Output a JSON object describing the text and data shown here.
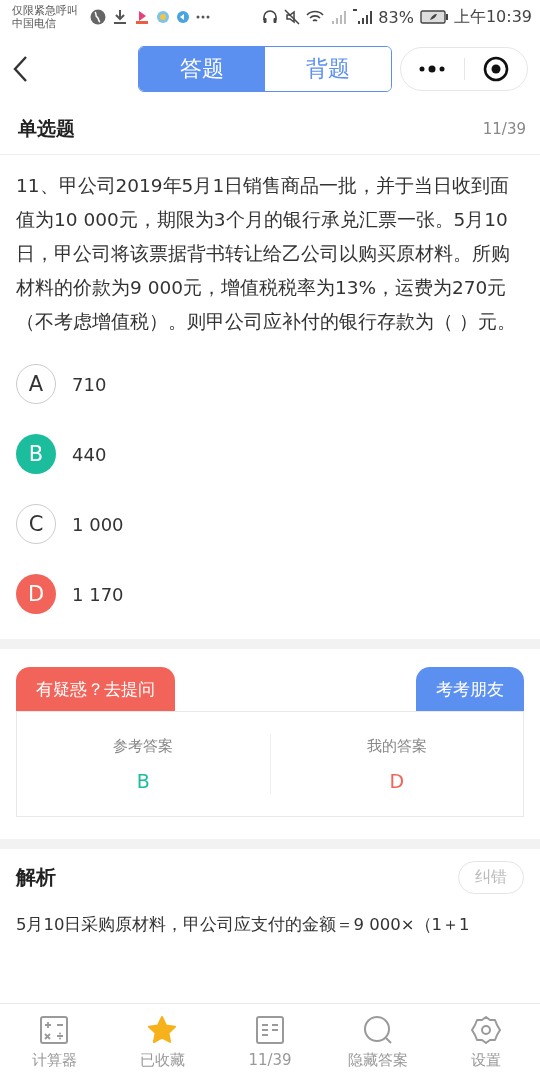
{
  "status_bar": {
    "carrier_lines": [
      "仅限紧急呼叫",
      "中国电信"
    ],
    "battery": "83%",
    "time": "上午10:39"
  },
  "header": {
    "tabs": [
      {
        "label": "答题",
        "selected": true
      },
      {
        "label": "背题",
        "selected": false
      }
    ]
  },
  "question": {
    "type": "单选题",
    "progress": "11/39",
    "text": "11、甲公司2019年5月1日销售商品一批，并于当日收到面值为10 000元，期限为3个月的银行承兑汇票一张。5月10日，甲公司将该票据背书转让给乙公司以购买原材料。所购材料的价款为9 000元，增值税税率为13%，运费为270元（不考虑增值税）。则甲公司应补付的银行存款为（ ）元。",
    "options": [
      {
        "letter": "A",
        "text": "710",
        "correct": false,
        "wrong": false
      },
      {
        "letter": "B",
        "text": "440",
        "correct": true,
        "wrong": false
      },
      {
        "letter": "C",
        "text": "1 000",
        "correct": false,
        "wrong": false
      },
      {
        "letter": "D",
        "text": "1 170",
        "correct": false,
        "wrong": true
      }
    ]
  },
  "answer": {
    "ask_button": "有疑惑？去提问",
    "friend_button": "考考朋友",
    "reference_label": "参考答案",
    "reference_value": "B",
    "mine_label": "我的答案",
    "mine_value": "D"
  },
  "analysis": {
    "title": "解析",
    "report_button": "纠错",
    "text": "5月10日采购原材料，甲公司应支付的金额＝9 000×（1＋1"
  },
  "bottom_nav": [
    {
      "kind": "calculator",
      "label": "计算器"
    },
    {
      "kind": "star",
      "label": "已收藏"
    },
    {
      "kind": "list",
      "label": "11/39"
    },
    {
      "kind": "search",
      "label": "隐藏答案"
    },
    {
      "kind": "gear",
      "label": "设置"
    }
  ]
}
